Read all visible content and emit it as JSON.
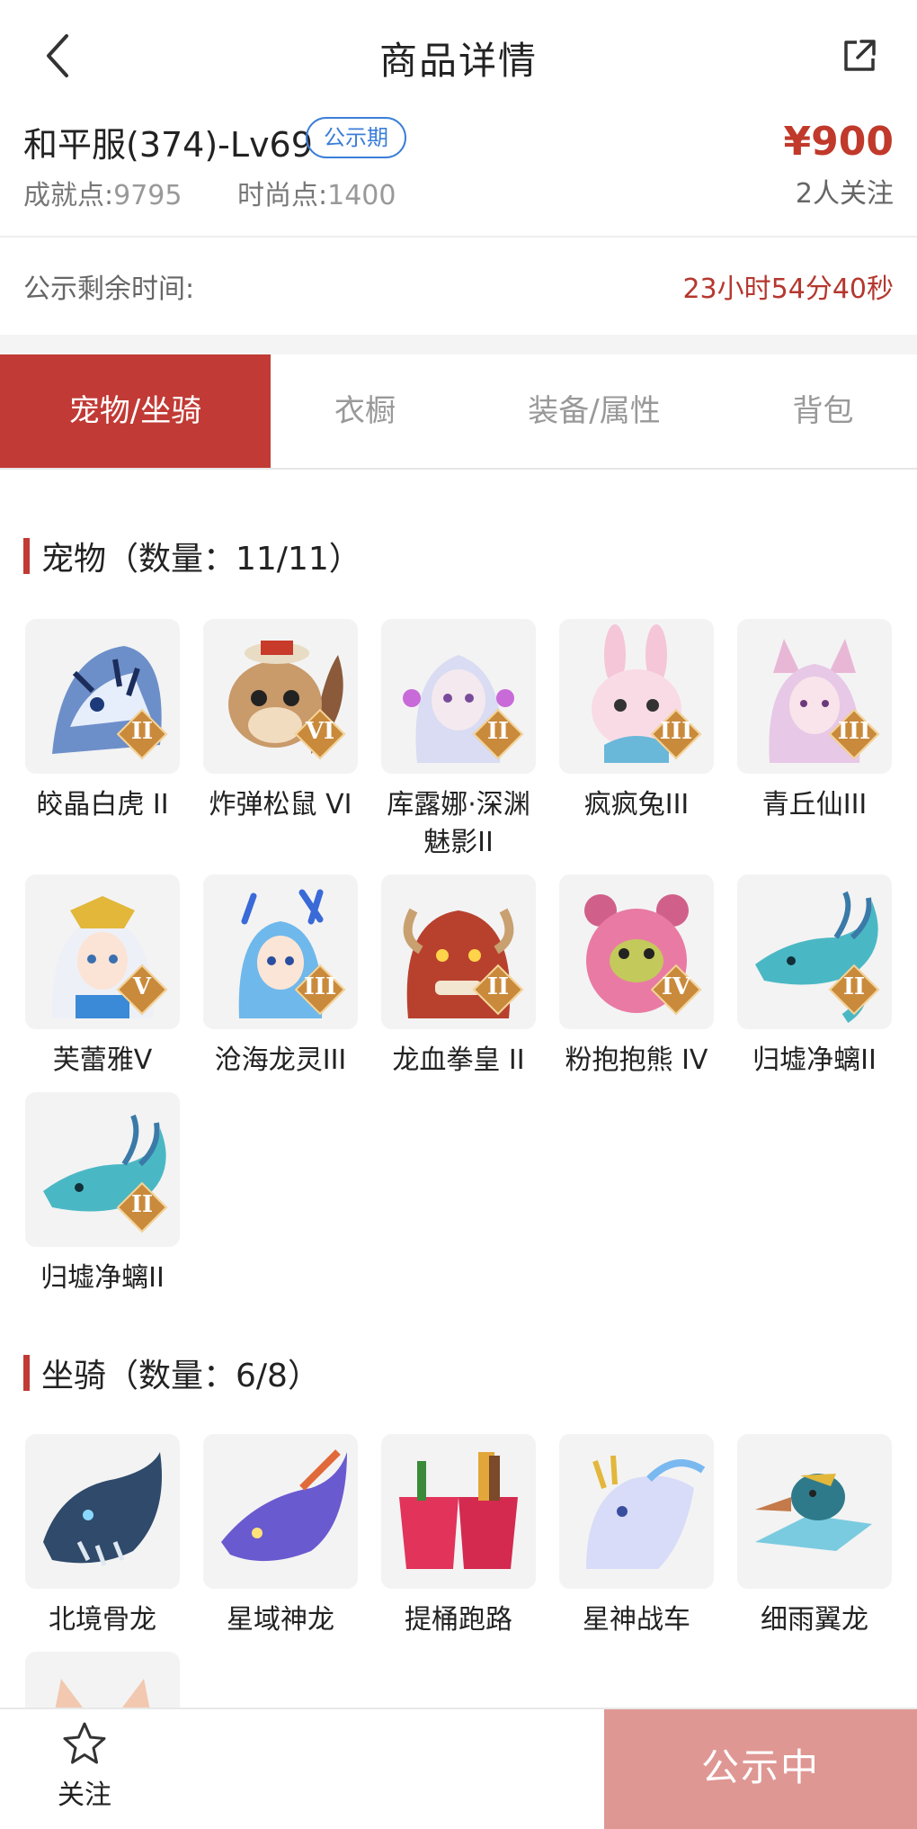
{
  "header": {
    "title": "商品详情"
  },
  "listing": {
    "server": "和平服(374)-Lv69",
    "status_badge": "公示期",
    "price": "¥900",
    "achievement_label": "成就点:",
    "achievement_value": "9795",
    "fashion_label": "时尚点:",
    "fashion_value": "1400",
    "followers": "2人关注"
  },
  "countdown": {
    "label": "公示剩余时间:",
    "value": "23小时54分40秒"
  },
  "tabs": [
    {
      "label": "宠物/坐骑",
      "active": true
    },
    {
      "label": "衣橱",
      "active": false
    },
    {
      "label": "装备/属性",
      "active": false
    },
    {
      "label": "背包",
      "active": false
    }
  ],
  "pets": {
    "title": "宠物（数量：11/11）",
    "items": [
      {
        "name": "皎晶白虎 II",
        "rank": "II",
        "icon": "white-tiger-icon"
      },
      {
        "name": "炸弹松鼠 VI",
        "rank": "VI",
        "icon": "squirrel-icon"
      },
      {
        "name": "库露娜·深渊魅影II",
        "rank": "II",
        "icon": "kuluna-icon"
      },
      {
        "name": "疯疯兔III",
        "rank": "III",
        "icon": "rabbit-icon"
      },
      {
        "name": "青丘仙III",
        "rank": "III",
        "icon": "fox-fairy-icon"
      },
      {
        "name": "芙蕾雅V",
        "rank": "V",
        "icon": "freya-icon"
      },
      {
        "name": "沧海龙灵III",
        "rank": "III",
        "icon": "sea-dragon-spirit-icon"
      },
      {
        "name": "龙血拳皇 II",
        "rank": "II",
        "icon": "dragon-fist-icon"
      },
      {
        "name": "粉抱抱熊 IV",
        "rank": "IV",
        "icon": "pink-bear-icon"
      },
      {
        "name": "归墟净螭II",
        "rank": "II",
        "icon": "jade-dragon-icon"
      },
      {
        "name": "归墟净螭II",
        "rank": "II",
        "icon": "jade-dragon-icon"
      }
    ]
  },
  "mounts": {
    "title": "坐骑（数量：6/8）",
    "items": [
      {
        "name": "北境骨龙",
        "icon": "bone-dragon-icon"
      },
      {
        "name": "星域神龙",
        "icon": "star-dragon-icon"
      },
      {
        "name": "提桶跑路",
        "icon": "bucket-icon"
      },
      {
        "name": "星神战车",
        "icon": "star-chariot-icon"
      },
      {
        "name": "细雨翼龙",
        "icon": "drizzle-wyvern-icon"
      },
      {
        "name": "",
        "icon": "fox-mount-icon"
      }
    ]
  },
  "bottom": {
    "follow_label": "关注",
    "action_label": "公示中"
  },
  "colors": {
    "accent": "#c13a35",
    "price": "#c0392b",
    "badge": "#3b7ed8",
    "action_bg": "#df9793"
  }
}
